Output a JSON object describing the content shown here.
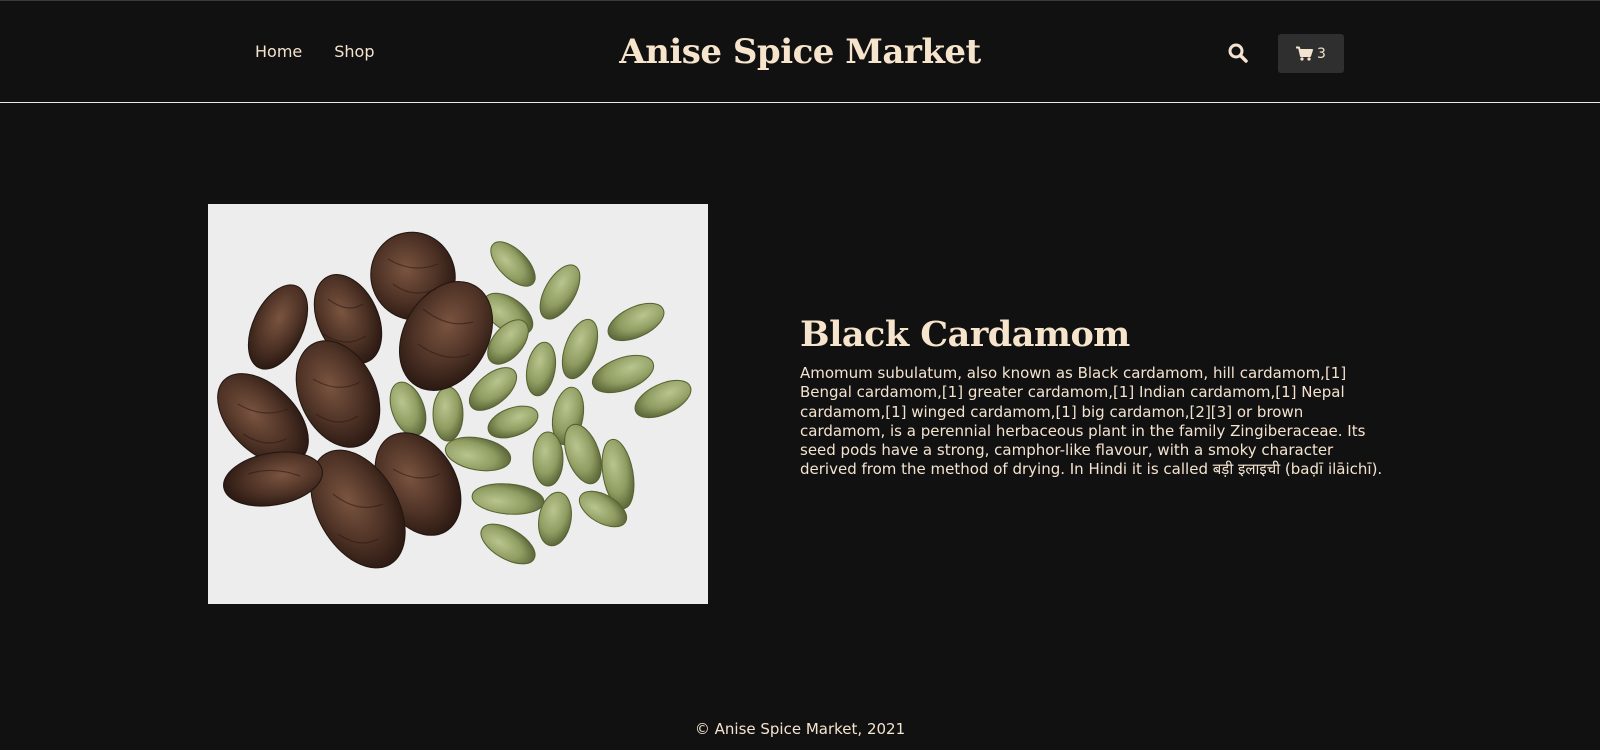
{
  "header": {
    "nav": [
      {
        "label": "Home"
      },
      {
        "label": "Shop"
      }
    ],
    "brand": "Anise Spice Market",
    "search_icon": "search-icon",
    "cart": {
      "icon": "cart-icon",
      "count": "3"
    }
  },
  "product": {
    "image_alt": "black-and-green-cardamom-pods",
    "title": "Black Cardamom",
    "description": "Amomum subulatum, also known as Black cardamom, hill cardamom,[1] Bengal cardamom,[1] greater cardamom,[1] Indian cardamom,[1] Nepal cardamom,[1] winged cardamom,[1] big cardamon,[2][3] or brown cardamom, is a perennial herbaceous plant in the family Zingiberaceae. Its seed pods have a strong, camphor-like flavour, with a smoky character derived from the method of drying. In Hindi it is called बड़ी इलाइची (baḍī ilāichī)."
  },
  "footer": {
    "copyright": "© Anise Spice Market, 2021"
  },
  "colors": {
    "background": "#111111",
    "text": "#f4e3cf",
    "cart_button_bg": "#2f2f2f",
    "header_divider": "#e9e9e9"
  }
}
